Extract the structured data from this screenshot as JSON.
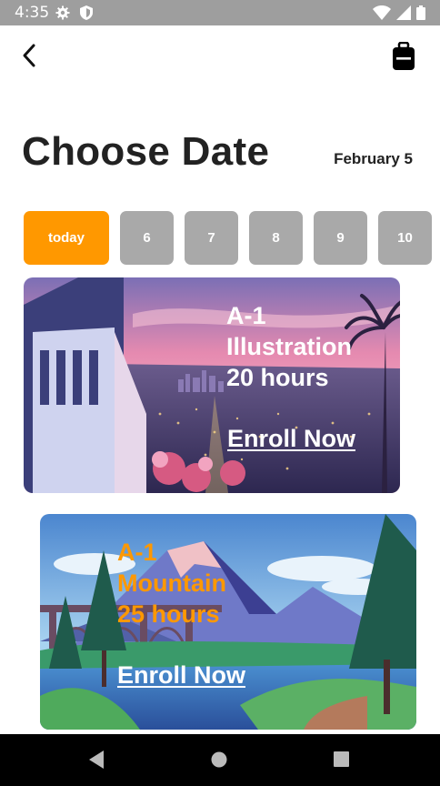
{
  "status_bar": {
    "time": "4:35",
    "icons": [
      "gear-icon",
      "shield-icon",
      "wifi-icon",
      "signal-icon",
      "battery-icon"
    ]
  },
  "header": {
    "back_icon": "chevron-left-icon",
    "bag_icon": "backpack-icon"
  },
  "page": {
    "title": "Choose Date",
    "selected_date": "February 5"
  },
  "date_chips": [
    {
      "label": "today",
      "active": true
    },
    {
      "label": "6",
      "active": false
    },
    {
      "label": "7",
      "active": false
    },
    {
      "label": "8",
      "active": false
    },
    {
      "label": "9",
      "active": false
    },
    {
      "label": "10",
      "active": false
    }
  ],
  "cards": [
    {
      "code": "A-1",
      "name": "Illustration",
      "duration": "20 hours",
      "cta": "Enroll Now",
      "text_color": "#ffffff"
    },
    {
      "code": "A-1",
      "name": "Mountain",
      "duration": "25 hours",
      "cta": "Enroll Now",
      "text_color": "#ff9800"
    }
  ],
  "colors": {
    "accent": "#ff9800",
    "chip_inactive": "#a9a9a9",
    "status_bar": "#9e9e9e",
    "nav_bar": "#000000"
  },
  "nav_bar": {
    "icons": [
      "back-triangle-icon",
      "home-circle-icon",
      "recents-square-icon"
    ]
  }
}
